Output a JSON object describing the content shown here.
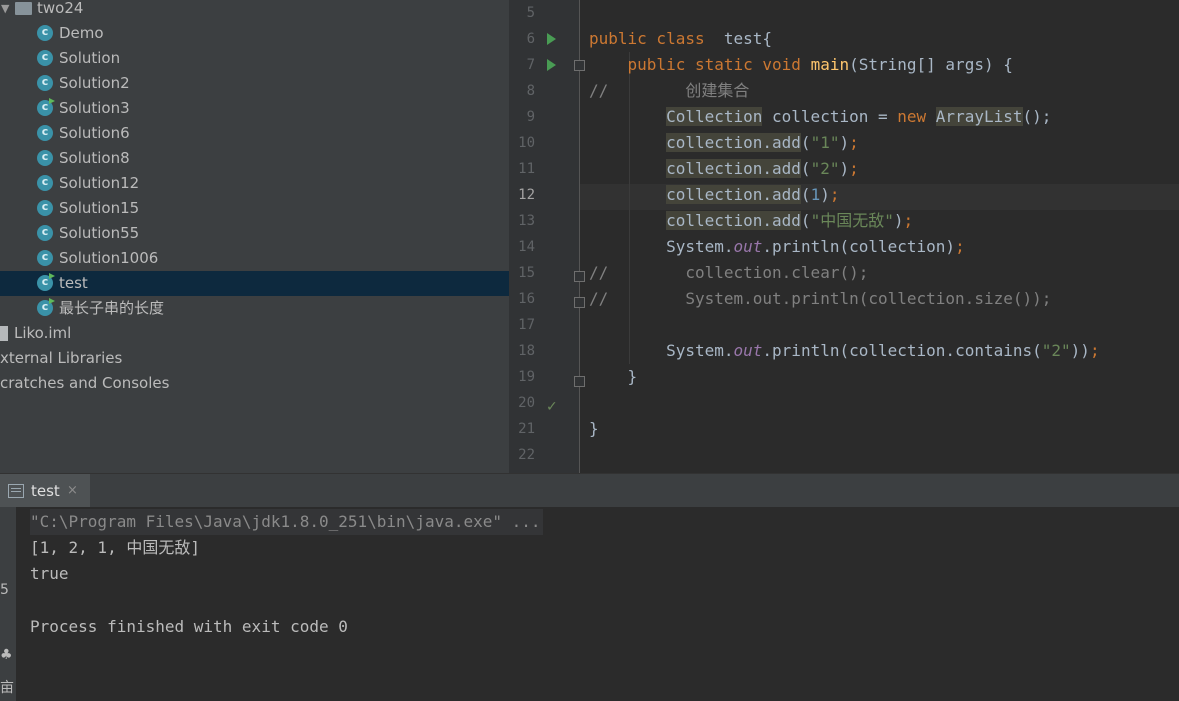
{
  "project_tree": {
    "package": "two24",
    "classes": [
      {
        "label": "Demo",
        "runnable": false
      },
      {
        "label": "Solution",
        "runnable": false
      },
      {
        "label": "Solution2",
        "runnable": false
      },
      {
        "label": "Solution3",
        "runnable": true
      },
      {
        "label": "Solution6",
        "runnable": false
      },
      {
        "label": "Solution8",
        "runnable": false
      },
      {
        "label": "Solution12",
        "runnable": false
      },
      {
        "label": "Solution15",
        "runnable": false
      },
      {
        "label": "Solution55",
        "runnable": false
      },
      {
        "label": "Solution1006",
        "runnable": false
      },
      {
        "label": "test",
        "runnable": true
      },
      {
        "label": "最长子串的长度",
        "runnable": true
      }
    ],
    "selected": "test",
    "iml_file": "Liko.iml",
    "external_libraries": "xternal Libraries",
    "scratches": "cratches and Consoles"
  },
  "editor": {
    "line_numbers": [
      "5",
      "6",
      "7",
      "8",
      "9",
      "10",
      "11",
      "12",
      "13",
      "14",
      "15",
      "16",
      "17",
      "18",
      "19",
      "20",
      "21",
      "22"
    ],
    "current_line": "12",
    "code": {
      "l6_kw": "public class",
      "l6_rest": "  test{",
      "l7_kw": "public static void",
      "l7_fn": "main",
      "l7_rest": "(String[] args) {",
      "l8_cmt": "//        创建集合",
      "l9_type": "Collection",
      "l9_mid": " collection = ",
      "l9_new": "new",
      "l9_cls": "ArrayList",
      "l9_end": "();",
      "l10_call": "collection.add",
      "l10_str": "\"1\"",
      "l11_call": "collection.add",
      "l11_str": "\"2\"",
      "l12_call": "collection.add",
      "l12_num": "1",
      "l13_call": "collection.add",
      "l13_str": "\"中国无敌\"",
      "l14_a": "System.",
      "l14_out": "out",
      "l14_b": ".println(collection)",
      "l15_cmt": "//        collection.clear();",
      "l16_cmt": "//        System.out.println(collection.size());",
      "l18_a": "System.",
      "l18_out": "out",
      "l18_b": ".println(collection.contains(",
      "l18_str": "\"2\"",
      "l18_end": "))",
      "l19": "}",
      "l21": "}"
    }
  },
  "run_panel": {
    "tab_label": "test",
    "tab_close": "×",
    "strip_glyphs": [
      "5",
      "♣",
      "亩"
    ],
    "output": [
      "\"C:\\Program Files\\Java\\jdk1.8.0_251\\bin\\java.exe\" ...",
      "[1, 2, 1, 中国无敌]",
      "true",
      "Process finished with exit code 0"
    ]
  },
  "colors": {
    "keyword": "#cc7832",
    "function": "#ffc66d",
    "string": "#6a8759",
    "number": "#6897bb",
    "comment": "#808080",
    "static_field": "#9876aa",
    "selection": "#0d293e",
    "run_icon": "#499c54"
  }
}
